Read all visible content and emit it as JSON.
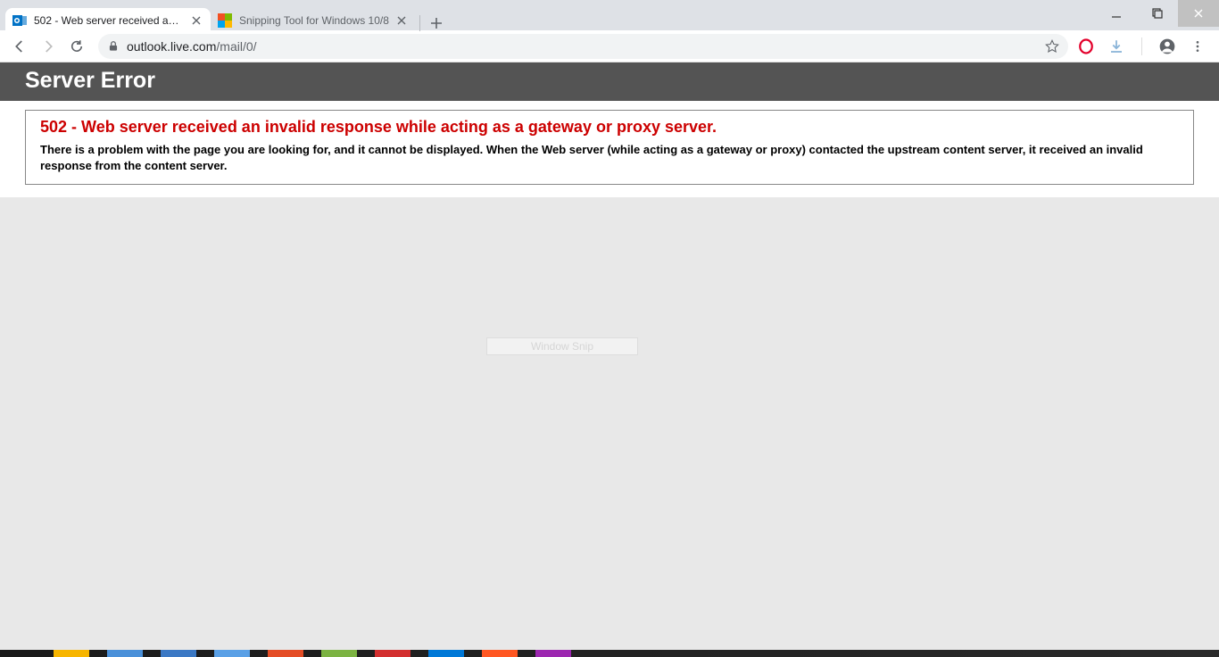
{
  "tabs": [
    {
      "title": "502 - Web server received an inv",
      "favicon": "outlook"
    },
    {
      "title": "Snipping Tool for Windows 10/8",
      "favicon": "snip"
    }
  ],
  "address": {
    "host": "outlook.live.com",
    "path": "/mail/0/"
  },
  "page": {
    "banner": "Server Error",
    "error_title": "502 - Web server received an invalid response while acting as a gateway or proxy server.",
    "error_body": "There is a problem with the page you are looking for, and it cannot be displayed. When the Web server (while acting as a gateway or proxy) contacted the upstream content server, it received an invalid response from the content server."
  },
  "tooltip": "Window Snip"
}
